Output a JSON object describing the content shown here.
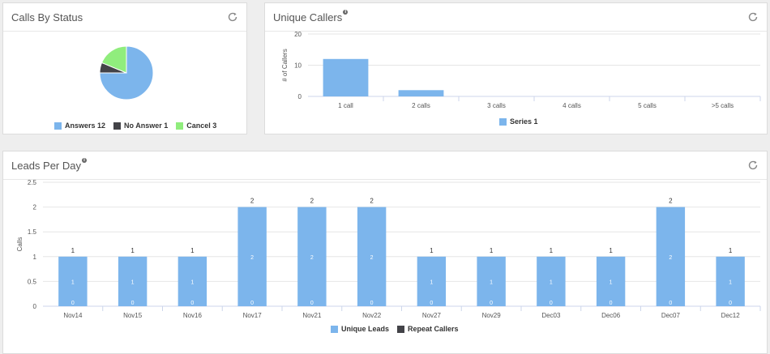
{
  "panels": {
    "calls_by_status": {
      "title": "Calls By Status"
    },
    "unique_callers": {
      "title": "Unique Callers"
    },
    "leads_per_day": {
      "title": "Leads Per Day"
    }
  },
  "colors": {
    "blue": "#7cb5ec",
    "dark": "#434348",
    "green": "#90ed7d"
  },
  "chart_data": [
    {
      "id": "calls_by_status",
      "type": "pie",
      "slices": [
        {
          "name": "Answers",
          "value": 12,
          "legend": "Answers 12",
          "color": "#7cb5ec"
        },
        {
          "name": "No Answer",
          "value": 1,
          "legend": "No Answer 1",
          "color": "#434348"
        },
        {
          "name": "Cancel",
          "value": 3,
          "legend": "Cancel 3",
          "color": "#90ed7d"
        }
      ]
    },
    {
      "id": "unique_callers",
      "type": "bar",
      "categories": [
        "1 call",
        "2 calls",
        "3 calls",
        "4 calls",
        "5 calls",
        ">5 calls"
      ],
      "series": [
        {
          "name": "Series 1",
          "values": [
            12,
            2,
            0,
            0,
            0,
            0
          ],
          "color": "#7cb5ec"
        }
      ],
      "ylabel": "# of Callers",
      "ylim": [
        0,
        20
      ],
      "yticks": [
        "0",
        "10",
        "20"
      ],
      "grid": true,
      "legend_position": "bottom"
    },
    {
      "id": "leads_per_day",
      "type": "bar",
      "stacked": true,
      "categories": [
        "Nov14",
        "Nov15",
        "Nov16",
        "Nov17",
        "Nov21",
        "Nov22",
        "Nov27",
        "Nov29",
        "Dec03",
        "Dec06",
        "Dec07",
        "Dec12"
      ],
      "series": [
        {
          "name": "Unique Leads",
          "values": [
            1,
            1,
            1,
            2,
            2,
            2,
            1,
            1,
            1,
            1,
            2,
            1
          ],
          "color": "#7cb5ec"
        },
        {
          "name": "Repeat Callers",
          "values": [
            0,
            0,
            0,
            0,
            0,
            0,
            0,
            0,
            0,
            0,
            0,
            0
          ],
          "color": "#434348"
        }
      ],
      "totals": [
        "1",
        "1",
        "1",
        "2",
        "2",
        "2",
        "1",
        "1",
        "1",
        "1",
        "2",
        "1"
      ],
      "ylabel": "Calls",
      "ylim": [
        0,
        2.5
      ],
      "yticks": [
        "0",
        "0.5",
        "1",
        "1.5",
        "2",
        "2.5"
      ],
      "grid": true,
      "legend_position": "bottom"
    }
  ]
}
